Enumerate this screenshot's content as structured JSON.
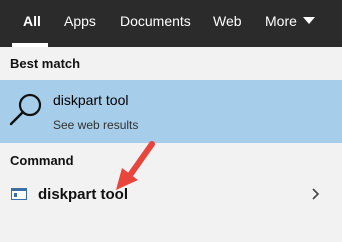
{
  "tabs": [
    {
      "label": "All",
      "active": true
    },
    {
      "label": "Apps",
      "active": false
    },
    {
      "label": "Documents",
      "active": false
    },
    {
      "label": "Web",
      "active": false
    },
    {
      "label": "More",
      "active": false
    }
  ],
  "sections": {
    "best_match_header": "Best match",
    "command_header": "Command"
  },
  "best_match": {
    "title": "diskpart tool",
    "subtitle": "See web results",
    "icon": "search-icon"
  },
  "command": {
    "label": "diskpart tool",
    "icon": "window-icon",
    "chevron_icon": "chevron-right-icon"
  },
  "colors": {
    "tabbar_bg": "#2b2b2b",
    "page_bg": "#f2f2f2",
    "highlight": "#a6cde9",
    "arrow": "#e8453c"
  }
}
